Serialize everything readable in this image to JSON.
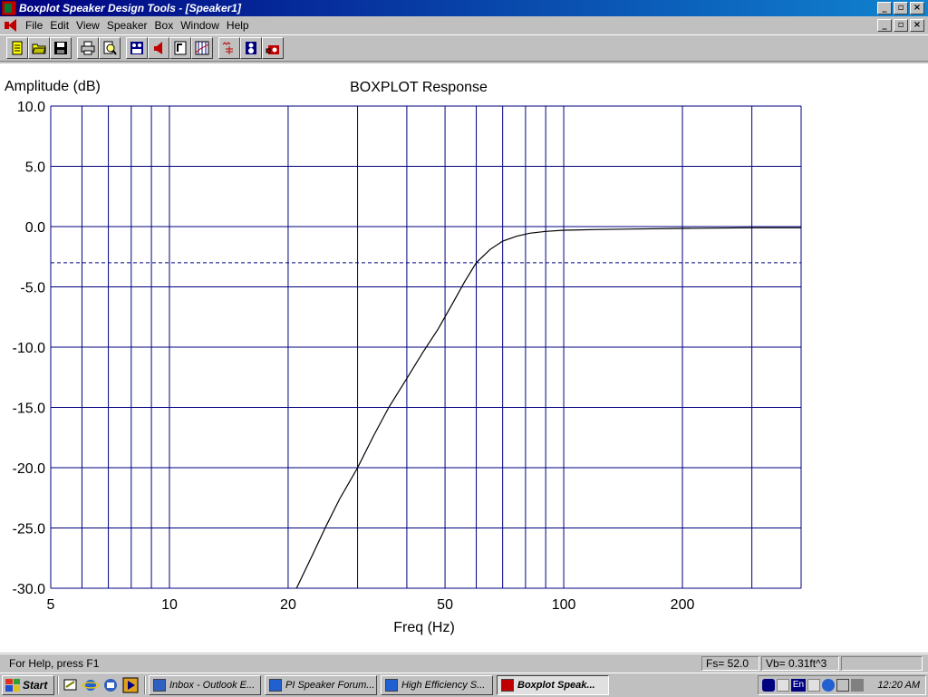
{
  "window": {
    "title": "Boxplot Speaker Design Tools - [Speaker1]",
    "controls": [
      "_",
      "▫",
      "×"
    ]
  },
  "menu": {
    "items": [
      "File",
      "Edit",
      "View",
      "Speaker",
      "Box",
      "Window",
      "Help"
    ]
  },
  "toolbar": {
    "buttons": [
      "new",
      "open",
      "save",
      "print",
      "preview",
      "speaker-params",
      "speaker",
      "export",
      "graph",
      "crossover",
      "box-design",
      "enclosure"
    ]
  },
  "chart_data": {
    "type": "line",
    "title": "BOXPLOT Response",
    "ylabel": "Amplitude (dB)",
    "xlabel": "Freq (Hz)",
    "xscale": "log",
    "xlim": [
      5,
      400
    ],
    "ylim": [
      -30,
      10
    ],
    "y_ticks": [
      "10.0",
      "5.0",
      "0.0",
      "-5.0",
      "-10.0",
      "-15.0",
      "-20.0",
      "-25.0",
      "-30.0"
    ],
    "y_tick_values": [
      10,
      5,
      0,
      -5,
      -10,
      -15,
      -20,
      -25,
      -30
    ],
    "x_tick_labels": [
      {
        "value": 5,
        "label": "5"
      },
      {
        "value": 10,
        "label": "10"
      },
      {
        "value": 20,
        "label": "20"
      },
      {
        "value": 50,
        "label": "50"
      },
      {
        "value": 100,
        "label": "100"
      },
      {
        "value": 200,
        "label": "200"
      }
    ],
    "x_gridlines": [
      6,
      7,
      8,
      9,
      10,
      20,
      30,
      40,
      50,
      60,
      70,
      80,
      90,
      100,
      200,
      300
    ],
    "reference_line": {
      "y": -3,
      "style": "dashed"
    },
    "grid": true,
    "colors": {
      "grid": "#000080",
      "curve": "#000000",
      "axis_text": "#000000"
    },
    "series": [
      {
        "x": [
          21,
          23,
          25,
          27,
          30,
          33,
          36,
          40,
          44,
          48,
          52,
          56,
          60,
          65,
          70,
          76,
          82,
          90,
          100,
          120,
          150,
          200,
          300,
          400
        ],
        "y": [
          -30,
          -27.3,
          -24.8,
          -22.6,
          -20,
          -17.3,
          -15,
          -12.6,
          -10.4,
          -8.5,
          -6.5,
          -4.6,
          -3,
          -1.9,
          -1.2,
          -0.8,
          -0.55,
          -0.4,
          -0.3,
          -0.25,
          -0.2,
          -0.15,
          -0.1,
          -0.1
        ]
      }
    ]
  },
  "status": {
    "help": "For Help, press F1",
    "fs": "Fs= 52.0",
    "vb": "Vb= 0.31ft^3",
    "extra": ""
  },
  "taskbar": {
    "start": "Start",
    "tasks": [
      {
        "label": "Inbox - Outlook E...",
        "active": false
      },
      {
        "label": "PI Speaker Forum...",
        "active": false
      },
      {
        "label": "High Efficiency S...",
        "active": false
      },
      {
        "label": "Boxplot Speak...",
        "active": true
      }
    ],
    "tray_lang": "En",
    "clock": "12:20 AM"
  }
}
